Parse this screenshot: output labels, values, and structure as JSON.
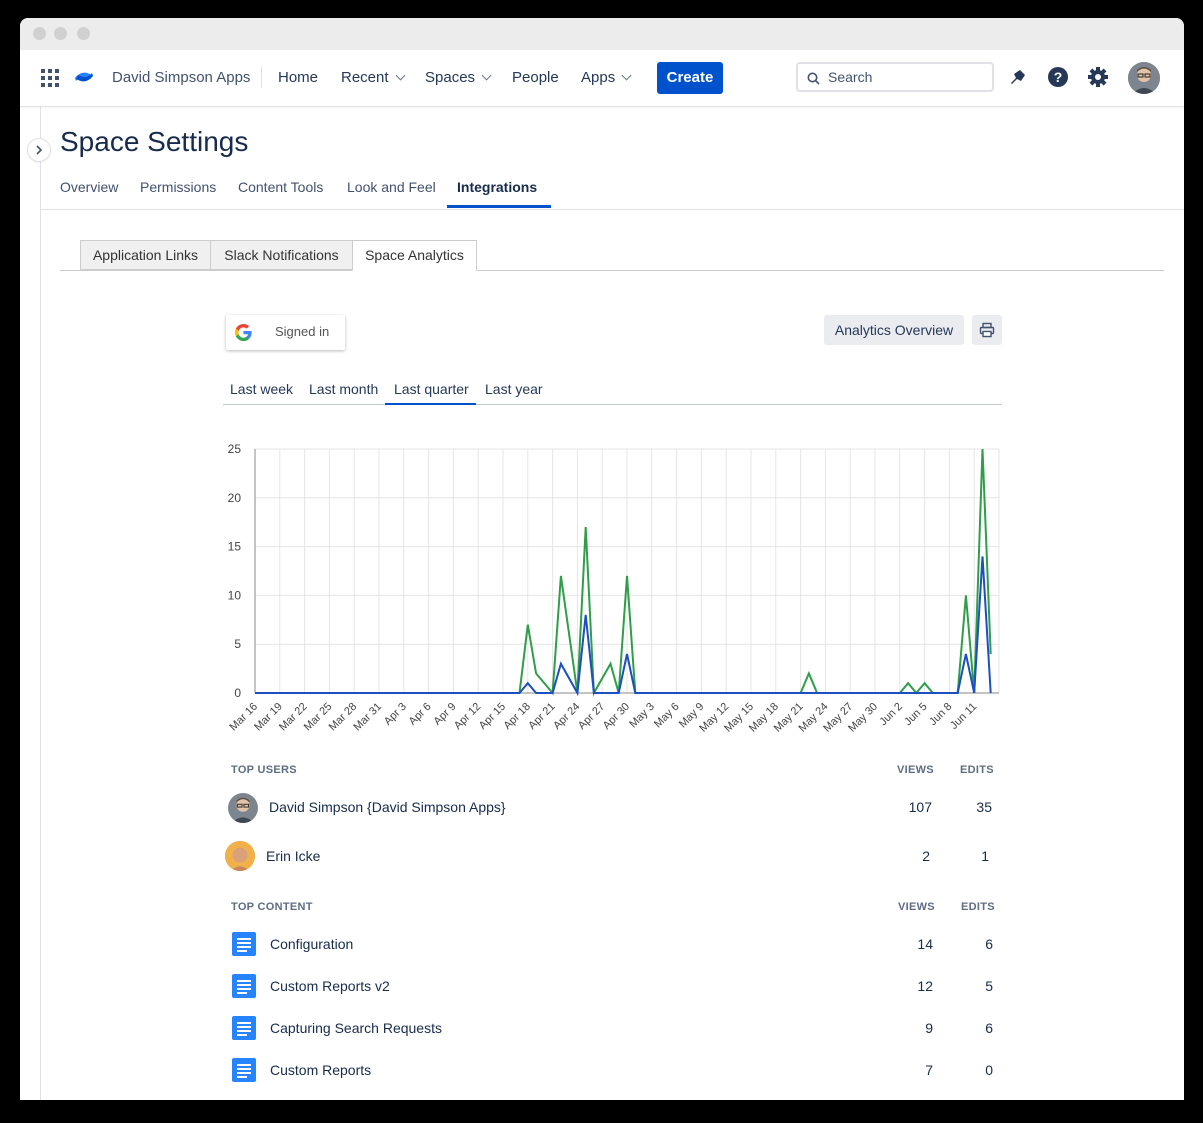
{
  "nav": {
    "space_name": "David Simpson Apps",
    "home": "Home",
    "recent": "Recent",
    "spaces": "Spaces",
    "people": "People",
    "apps": "Apps",
    "create": "Create",
    "search_placeholder": "Search"
  },
  "page": {
    "title": "Space Settings",
    "tabs": [
      "Overview",
      "Permissions",
      "Content Tools",
      "Look and Feel",
      "Integrations"
    ],
    "active_tab": "Integrations"
  },
  "subtabs": [
    "Application Links",
    "Slack Notifications",
    "Space Analytics"
  ],
  "active_subtab": "Space Analytics",
  "analytics": {
    "signed_in": "Signed in",
    "overview_button": "Analytics Overview",
    "ranges": [
      "Last week",
      "Last month",
      "Last quarter",
      "Last year"
    ],
    "active_range": "Last quarter"
  },
  "colors": {
    "accent": "#0052cc",
    "views_line": "#2e9e48",
    "edits_line": "#1c4fbf"
  },
  "chart_data": {
    "type": "line",
    "title": "",
    "xlabel": "",
    "ylabel": "",
    "ylim": [
      0,
      25
    ],
    "yticks": [
      0,
      5,
      10,
      15,
      20,
      25
    ],
    "grid": true,
    "x_labels": [
      "Mar 16",
      "Mar 19",
      "Mar 22",
      "Mar 25",
      "Mar 28",
      "Mar 31",
      "Apr 3",
      "Apr 6",
      "Apr 9",
      "Apr 12",
      "Apr 15",
      "Apr 18",
      "Apr 21",
      "Apr 24",
      "Apr 27",
      "Apr 30",
      "May 3",
      "May 6",
      "May 9",
      "May 12",
      "May 15",
      "May 18",
      "May 21",
      "May 24",
      "May 27",
      "May 30",
      "Jun 2",
      "Jun 5",
      "Jun 8",
      "Jun 11"
    ],
    "x_start": "Mar 16",
    "series": [
      {
        "color": "#2e9e48",
        "values": [
          0,
          0,
          0,
          0,
          0,
          0,
          0,
          0,
          0,
          0,
          0,
          0,
          0,
          0,
          0,
          0,
          0,
          0,
          0,
          0,
          0,
          0,
          0,
          0,
          0,
          0,
          0,
          0,
          0,
          0,
          0,
          0,
          0,
          0,
          0,
          0,
          0,
          0,
          0,
          0,
          0,
          0,
          0,
          0,
          0,
          0,
          0,
          0,
          0,
          0,
          0,
          0,
          0,
          0,
          0,
          0,
          0,
          0,
          0,
          0,
          0,
          0,
          0,
          0,
          0,
          0,
          0,
          0,
          0,
          0,
          0,
          0,
          0,
          0,
          0,
          0,
          0,
          0,
          0,
          0,
          0,
          0,
          0,
          0,
          0,
          0,
          0,
          0,
          0,
          0,
          0,
          0,
          0,
          0,
          0,
          0,
          0,
          0,
          0,
          0,
          0,
          0,
          0,
          0,
          0,
          0,
          0,
          0,
          0,
          0,
          0,
          0,
          0,
          0,
          0,
          0,
          0,
          0,
          0
        ]
      },
      {
        "color": "#1c4fbf",
        "values": []
      }
    ],
    "points_green": [
      [
        0,
        0
      ],
      [
        32,
        0
      ],
      [
        33,
        7
      ],
      [
        34,
        2
      ],
      [
        36,
        0
      ],
      [
        37,
        12
      ],
      [
        39,
        0
      ],
      [
        40,
        17
      ],
      [
        41,
        0
      ],
      [
        43,
        3
      ],
      [
        44,
        0
      ],
      [
        45,
        12
      ],
      [
        46,
        0
      ],
      [
        66,
        0
      ],
      [
        67,
        2
      ],
      [
        68,
        0
      ],
      [
        78,
        0
      ],
      [
        79,
        1
      ],
      [
        80,
        0
      ],
      [
        81,
        1
      ],
      [
        82,
        0
      ],
      [
        85,
        0
      ],
      [
        86,
        10
      ],
      [
        87,
        0
      ],
      [
        88,
        25
      ],
      [
        89,
        4
      ]
    ],
    "points_blue": [
      [
        0,
        0
      ],
      [
        32,
        0
      ],
      [
        33,
        1
      ],
      [
        34,
        0
      ],
      [
        36,
        0
      ],
      [
        37,
        3
      ],
      [
        39,
        0
      ],
      [
        40,
        8
      ],
      [
        41,
        0
      ],
      [
        44,
        0
      ],
      [
        45,
        4
      ],
      [
        46,
        0
      ],
      [
        85,
        0
      ],
      [
        86,
        4
      ],
      [
        87,
        0
      ],
      [
        88,
        14
      ],
      [
        89,
        0
      ]
    ]
  },
  "top_users": {
    "heading": "TOP USERS",
    "views_label": "VIEWS",
    "edits_label": "EDITS",
    "rows": [
      {
        "name": "David Simpson {David Simpson Apps}",
        "views": "107",
        "edits": "35"
      },
      {
        "name": "Erin Icke",
        "views": "2",
        "edits": "1"
      }
    ]
  },
  "top_content": {
    "heading": "TOP CONTENT",
    "views_label": "VIEWS",
    "edits_label": "EDITS",
    "rows": [
      {
        "name": "Configuration",
        "views": "14",
        "edits": "6"
      },
      {
        "name": "Custom Reports v2",
        "views": "12",
        "edits": "5"
      },
      {
        "name": "Capturing Search Requests",
        "views": "9",
        "edits": "6"
      },
      {
        "name": "Custom Reports",
        "views": "7",
        "edits": "0"
      }
    ]
  }
}
